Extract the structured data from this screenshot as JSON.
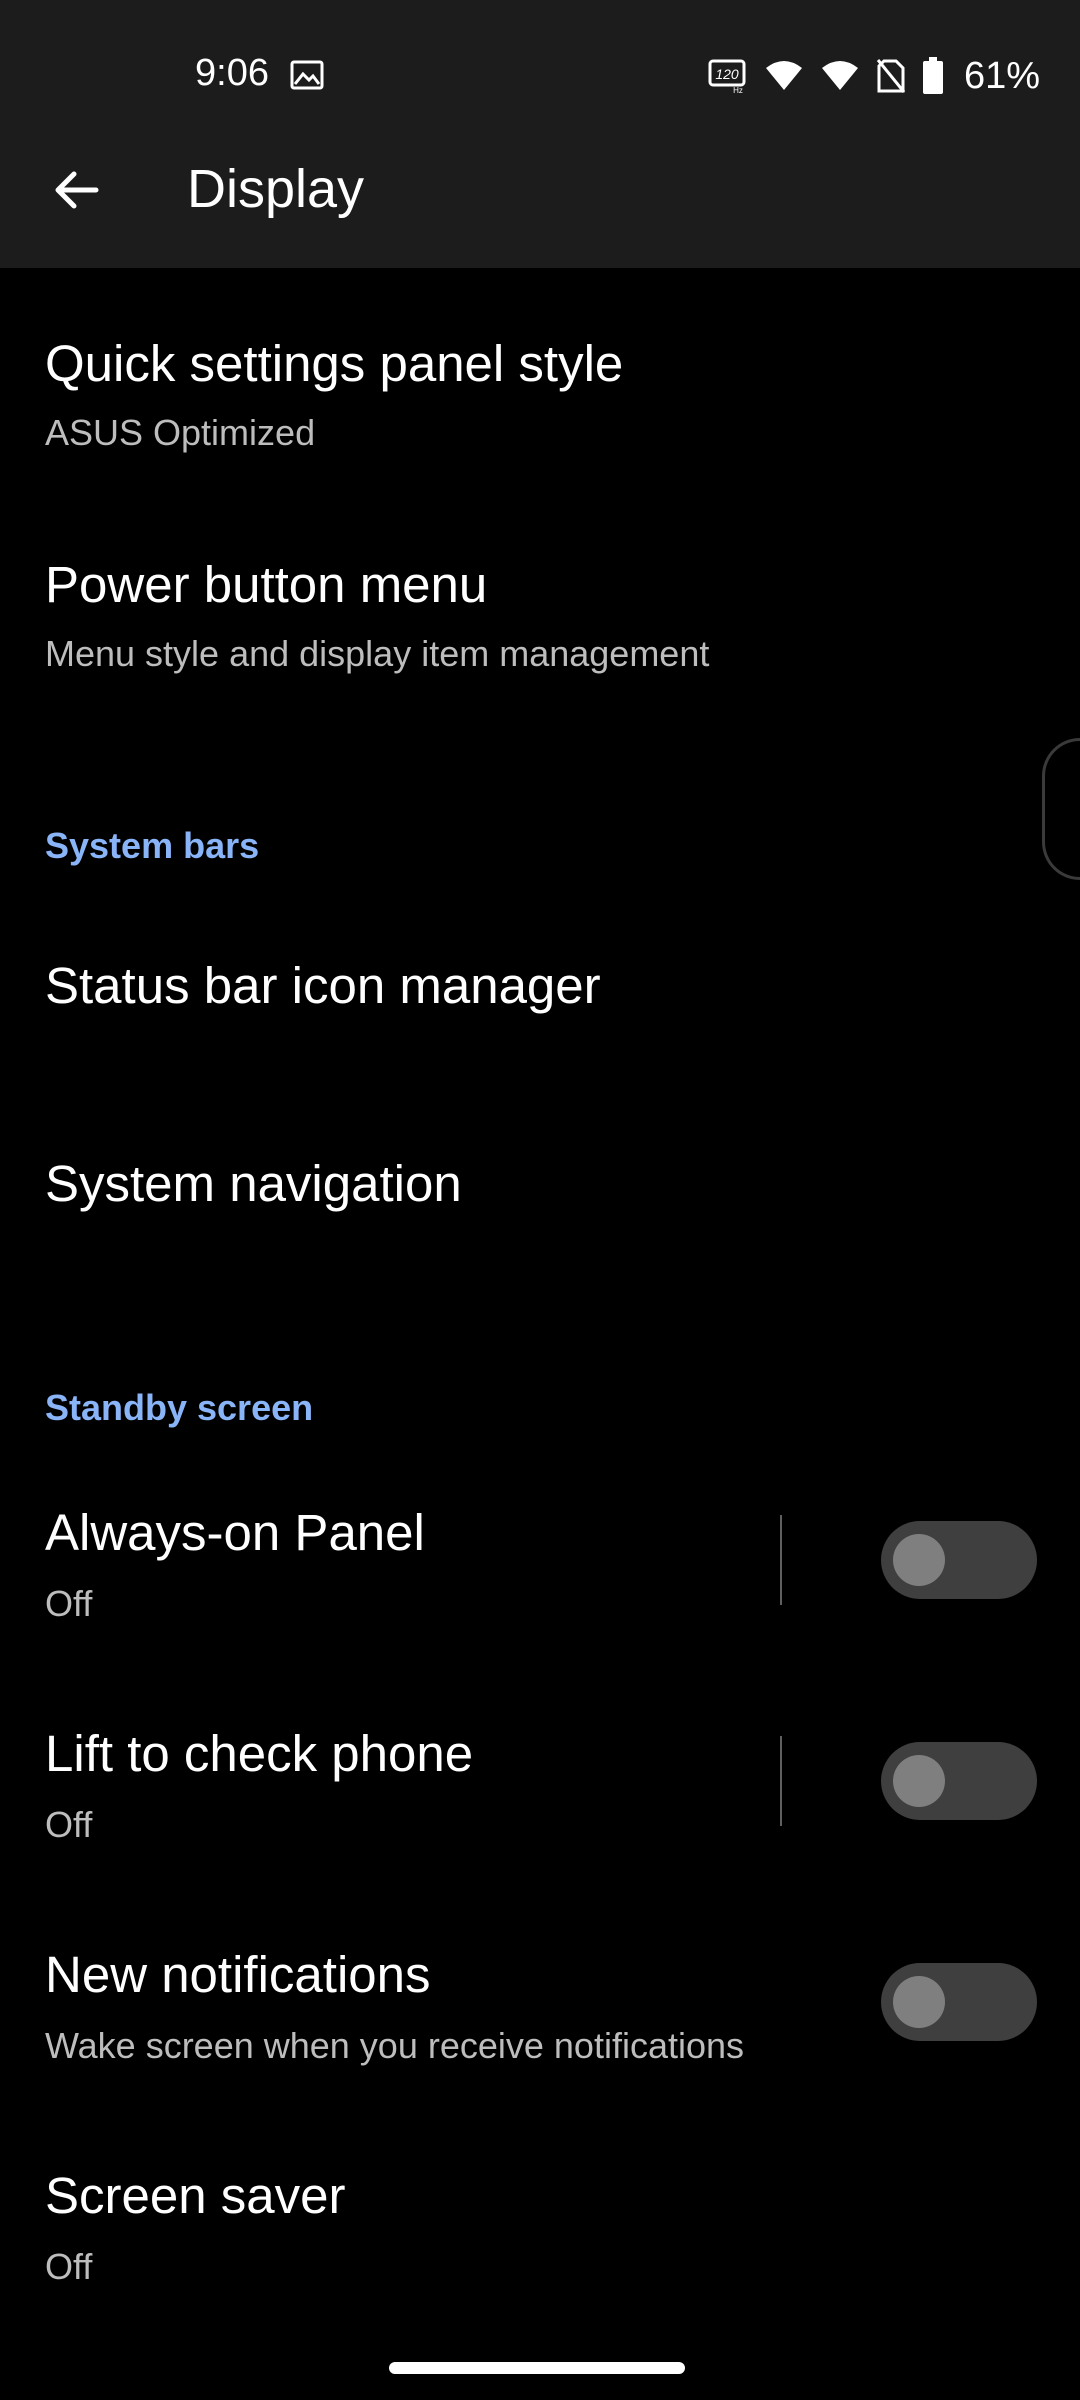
{
  "status_bar": {
    "time": "9:06",
    "refresh_badge": "120",
    "battery": "61%"
  },
  "app_bar": {
    "title": "Display"
  },
  "items": {
    "quick_settings": {
      "title": "Quick settings panel style",
      "subtitle": "ASUS Optimized"
    },
    "power_menu": {
      "title": "Power button menu",
      "subtitle": "Menu style and display item management"
    },
    "status_bar_icons": {
      "title": "Status bar icon manager"
    },
    "system_navigation": {
      "title": "System navigation"
    },
    "always_on": {
      "title": "Always-on Panel",
      "subtitle": "Off",
      "enabled": false
    },
    "lift_to_check": {
      "title": "Lift to check phone",
      "subtitle": "Off",
      "enabled": false
    },
    "new_notifications": {
      "title": "New notifications",
      "subtitle": "Wake screen when you receive notifications",
      "enabled": false
    },
    "screen_saver": {
      "title": "Screen saver",
      "subtitle": "Off"
    }
  },
  "sections": {
    "system_bars": "System bars",
    "standby_screen": "Standby screen"
  },
  "colors": {
    "accent": "#8ab4f8",
    "background": "#000000",
    "app_bar": "#1c1c1c"
  }
}
